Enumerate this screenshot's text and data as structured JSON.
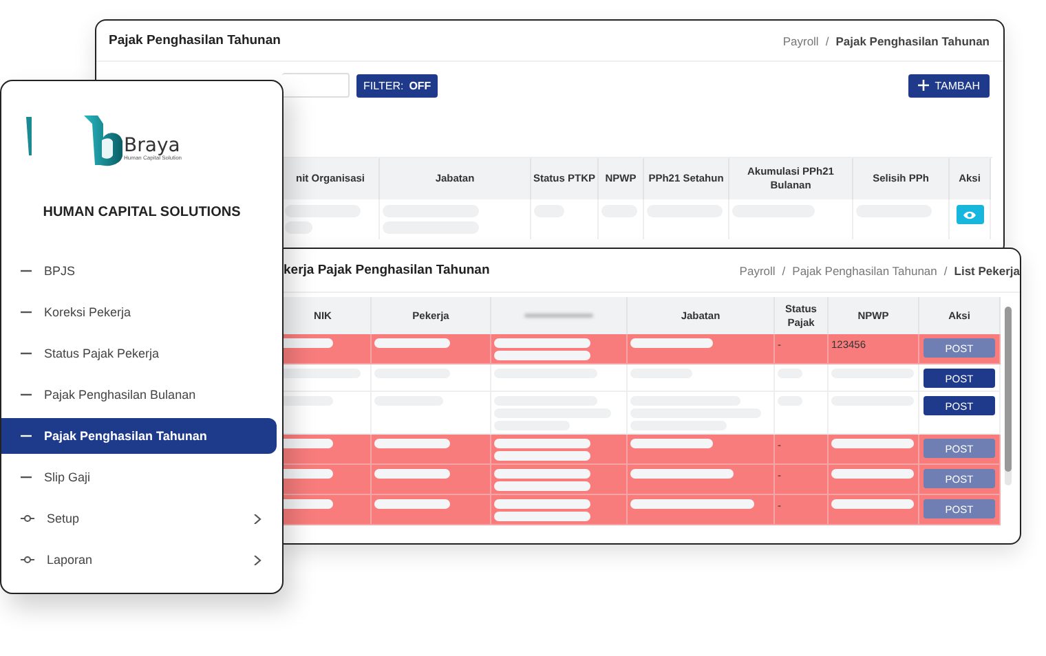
{
  "back_window": {
    "title": "Pajak Penghasilan Tahunan",
    "breadcrumb": [
      {
        "label": "Payroll",
        "current": false
      },
      {
        "separator": "/"
      },
      {
        "label": "Pajak Penghasilan Tahunan",
        "current": true
      }
    ],
    "filter_button": {
      "label": "FILTER:",
      "value": "OFF"
    },
    "add_button": "TAMBAH",
    "table": {
      "columns": [
        {
          "label": "nit Organisasi"
        },
        {
          "label": "Jabatan"
        },
        {
          "label": "Status PTKP"
        },
        {
          "label": "NPWP"
        },
        {
          "label": "PPh21 Setahun"
        },
        {
          "label": "Akumulasi PPh21 Bulanan"
        },
        {
          "label": "Selisih PPh"
        },
        {
          "label": "Aksi"
        }
      ]
    }
  },
  "front_window": {
    "title": "kerja Pajak Penghasilan Tahunan",
    "breadcrumb": [
      {
        "label": "Payroll",
        "current": false
      },
      {
        "separator": "/"
      },
      {
        "label": "Pajak Penghasilan Tahunan",
        "current": false
      },
      {
        "separator": "/"
      },
      {
        "label": "List Pekerja",
        "current": true
      }
    ],
    "table": {
      "columns": [
        {
          "label": "NIK"
        },
        {
          "label": "Pekerja"
        },
        {
          "kind": "blurred"
        },
        {
          "label": "Jabatan"
        },
        {
          "label": "Status Pajak"
        },
        {
          "label": "NPWP"
        },
        {
          "label": "Aksi"
        }
      ],
      "rows": [
        {
          "highlighted": true,
          "status_pajak": "-",
          "npwp": "123456",
          "action": {
            "label": "POST",
            "disabled": true
          }
        },
        {
          "highlighted": false,
          "action": {
            "label": "POST",
            "disabled": false
          }
        },
        {
          "highlighted": false,
          "action": {
            "label": "POST",
            "disabled": false
          }
        },
        {
          "highlighted": true,
          "status_pajak": "-",
          "action": {
            "label": "POST",
            "disabled": true
          }
        },
        {
          "highlighted": true,
          "status_pajak": "-",
          "action": {
            "label": "POST",
            "disabled": true
          }
        },
        {
          "highlighted": true,
          "status_pajak": "-",
          "action": {
            "label": "POST",
            "disabled": true
          }
        }
      ]
    }
  },
  "sidebar": {
    "logo": {
      "name": "Braya",
      "tagline": "Human Capital Solution"
    },
    "heading": "HUMAN CAPITAL SOLUTIONS",
    "items": [
      {
        "label": "BPJS",
        "kind": "link",
        "selected": false
      },
      {
        "label": "Koreksi Pekerja",
        "kind": "link",
        "selected": false
      },
      {
        "label": "Status Pajak Pekerja",
        "kind": "link",
        "selected": false
      },
      {
        "label": "Pajak Penghasilan Bulanan",
        "kind": "link",
        "selected": false
      },
      {
        "label": "Pajak Penghasilan Tahunan",
        "kind": "link",
        "selected": true
      },
      {
        "label": "Slip Gaji",
        "kind": "link",
        "selected": false
      },
      {
        "label": "Setup",
        "kind": "group",
        "selected": false,
        "expanded": false
      },
      {
        "label": "Laporan",
        "kind": "group",
        "selected": false,
        "expanded": false
      }
    ]
  }
}
